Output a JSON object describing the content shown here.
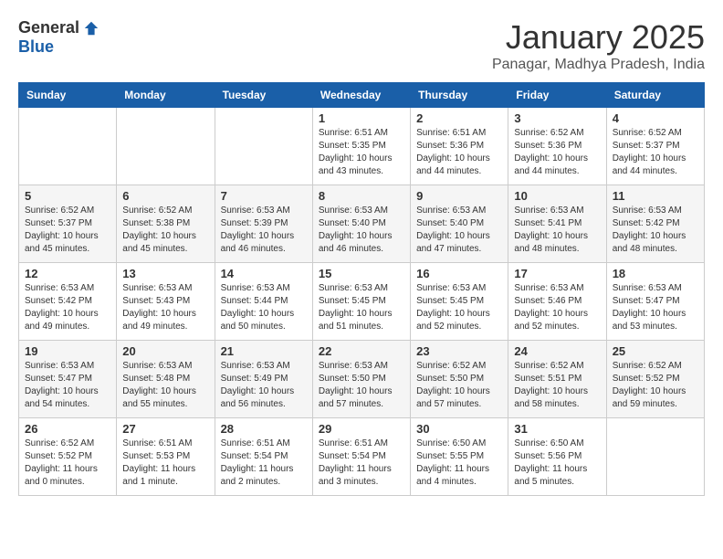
{
  "header": {
    "logo_general": "General",
    "logo_blue": "Blue",
    "month_title": "January 2025",
    "location": "Panagar, Madhya Pradesh, India"
  },
  "days_of_week": [
    "Sunday",
    "Monday",
    "Tuesday",
    "Wednesday",
    "Thursday",
    "Friday",
    "Saturday"
  ],
  "weeks": [
    [
      {
        "day": "",
        "info": ""
      },
      {
        "day": "",
        "info": ""
      },
      {
        "day": "",
        "info": ""
      },
      {
        "day": "1",
        "info": "Sunrise: 6:51 AM\nSunset: 5:35 PM\nDaylight: 10 hours\nand 43 minutes."
      },
      {
        "day": "2",
        "info": "Sunrise: 6:51 AM\nSunset: 5:36 PM\nDaylight: 10 hours\nand 44 minutes."
      },
      {
        "day": "3",
        "info": "Sunrise: 6:52 AM\nSunset: 5:36 PM\nDaylight: 10 hours\nand 44 minutes."
      },
      {
        "day": "4",
        "info": "Sunrise: 6:52 AM\nSunset: 5:37 PM\nDaylight: 10 hours\nand 44 minutes."
      }
    ],
    [
      {
        "day": "5",
        "info": "Sunrise: 6:52 AM\nSunset: 5:37 PM\nDaylight: 10 hours\nand 45 minutes."
      },
      {
        "day": "6",
        "info": "Sunrise: 6:52 AM\nSunset: 5:38 PM\nDaylight: 10 hours\nand 45 minutes."
      },
      {
        "day": "7",
        "info": "Sunrise: 6:53 AM\nSunset: 5:39 PM\nDaylight: 10 hours\nand 46 minutes."
      },
      {
        "day": "8",
        "info": "Sunrise: 6:53 AM\nSunset: 5:40 PM\nDaylight: 10 hours\nand 46 minutes."
      },
      {
        "day": "9",
        "info": "Sunrise: 6:53 AM\nSunset: 5:40 PM\nDaylight: 10 hours\nand 47 minutes."
      },
      {
        "day": "10",
        "info": "Sunrise: 6:53 AM\nSunset: 5:41 PM\nDaylight: 10 hours\nand 48 minutes."
      },
      {
        "day": "11",
        "info": "Sunrise: 6:53 AM\nSunset: 5:42 PM\nDaylight: 10 hours\nand 48 minutes."
      }
    ],
    [
      {
        "day": "12",
        "info": "Sunrise: 6:53 AM\nSunset: 5:42 PM\nDaylight: 10 hours\nand 49 minutes."
      },
      {
        "day": "13",
        "info": "Sunrise: 6:53 AM\nSunset: 5:43 PM\nDaylight: 10 hours\nand 49 minutes."
      },
      {
        "day": "14",
        "info": "Sunrise: 6:53 AM\nSunset: 5:44 PM\nDaylight: 10 hours\nand 50 minutes."
      },
      {
        "day": "15",
        "info": "Sunrise: 6:53 AM\nSunset: 5:45 PM\nDaylight: 10 hours\nand 51 minutes."
      },
      {
        "day": "16",
        "info": "Sunrise: 6:53 AM\nSunset: 5:45 PM\nDaylight: 10 hours\nand 52 minutes."
      },
      {
        "day": "17",
        "info": "Sunrise: 6:53 AM\nSunset: 5:46 PM\nDaylight: 10 hours\nand 52 minutes."
      },
      {
        "day": "18",
        "info": "Sunrise: 6:53 AM\nSunset: 5:47 PM\nDaylight: 10 hours\nand 53 minutes."
      }
    ],
    [
      {
        "day": "19",
        "info": "Sunrise: 6:53 AM\nSunset: 5:47 PM\nDaylight: 10 hours\nand 54 minutes."
      },
      {
        "day": "20",
        "info": "Sunrise: 6:53 AM\nSunset: 5:48 PM\nDaylight: 10 hours\nand 55 minutes."
      },
      {
        "day": "21",
        "info": "Sunrise: 6:53 AM\nSunset: 5:49 PM\nDaylight: 10 hours\nand 56 minutes."
      },
      {
        "day": "22",
        "info": "Sunrise: 6:53 AM\nSunset: 5:50 PM\nDaylight: 10 hours\nand 57 minutes."
      },
      {
        "day": "23",
        "info": "Sunrise: 6:52 AM\nSunset: 5:50 PM\nDaylight: 10 hours\nand 57 minutes."
      },
      {
        "day": "24",
        "info": "Sunrise: 6:52 AM\nSunset: 5:51 PM\nDaylight: 10 hours\nand 58 minutes."
      },
      {
        "day": "25",
        "info": "Sunrise: 6:52 AM\nSunset: 5:52 PM\nDaylight: 10 hours\nand 59 minutes."
      }
    ],
    [
      {
        "day": "26",
        "info": "Sunrise: 6:52 AM\nSunset: 5:52 PM\nDaylight: 11 hours\nand 0 minutes."
      },
      {
        "day": "27",
        "info": "Sunrise: 6:51 AM\nSunset: 5:53 PM\nDaylight: 11 hours\nand 1 minute."
      },
      {
        "day": "28",
        "info": "Sunrise: 6:51 AM\nSunset: 5:54 PM\nDaylight: 11 hours\nand 2 minutes."
      },
      {
        "day": "29",
        "info": "Sunrise: 6:51 AM\nSunset: 5:54 PM\nDaylight: 11 hours\nand 3 minutes."
      },
      {
        "day": "30",
        "info": "Sunrise: 6:50 AM\nSunset: 5:55 PM\nDaylight: 11 hours\nand 4 minutes."
      },
      {
        "day": "31",
        "info": "Sunrise: 6:50 AM\nSunset: 5:56 PM\nDaylight: 11 hours\nand 5 minutes."
      },
      {
        "day": "",
        "info": ""
      }
    ]
  ]
}
